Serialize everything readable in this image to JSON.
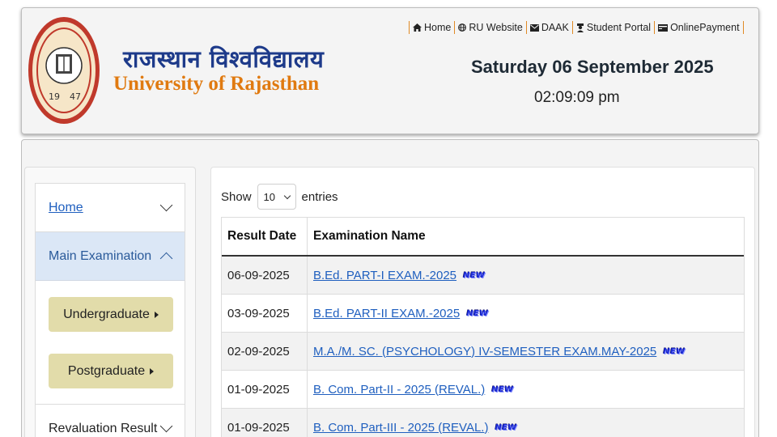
{
  "header": {
    "university_hindi": "राजस्थान विश्वविद्यालय",
    "university_english": "University of Rajasthan",
    "date": "Saturday 06 September 2025",
    "time": "02:09:09 pm",
    "nav": [
      {
        "label": "Home",
        "icon": "home-icon"
      },
      {
        "label": "RU Website",
        "icon": "globe-icon"
      },
      {
        "label": "DAAK",
        "icon": "envelope-icon"
      },
      {
        "label": "Student Portal",
        "icon": "student-icon"
      },
      {
        "label": "OnlinePayment",
        "icon": "card-icon"
      }
    ],
    "logo_text": "राजस्थान विश्वविद्यालय",
    "logo_year_left": "19",
    "logo_year_right": "47",
    "accent_separator": "#e08a25"
  },
  "sidebar": {
    "home_label": "Home",
    "main_exam_label": "Main Examination",
    "undergraduate_label": "Undergraduate",
    "postgraduate_label": "Postgraduate",
    "revaluation_label": "Revaluation Result"
  },
  "table": {
    "show_label": "Show",
    "entries_label": "entries",
    "page_size": "10",
    "headers": [
      "Result Date",
      "Examination Name"
    ],
    "new_badge": "NEW",
    "rows": [
      {
        "date": "06-09-2025",
        "exam": "B.Ed. PART-I EXAM.-2025"
      },
      {
        "date": "03-09-2025",
        "exam": "B.Ed. PART-II EXAM.-2025"
      },
      {
        "date": "02-09-2025",
        "exam": "M.A./M. SC. (PSYCHOLOGY) IV-SEMESTER EXAM.MAY-2025"
      },
      {
        "date": "01-09-2025",
        "exam": "B. Com. Part-II - 2025 (REVAL.)"
      },
      {
        "date": "01-09-2025",
        "exam": "B. Com. Part-III - 2025 (REVAL.)"
      }
    ]
  },
  "colors": {
    "link": "#1f5fbf",
    "button_bg": "#e2dcaa",
    "active_menu_bg": "#dbe7f6",
    "brand_orange": "#e07a10",
    "brand_blue": "#1d3a8a"
  }
}
